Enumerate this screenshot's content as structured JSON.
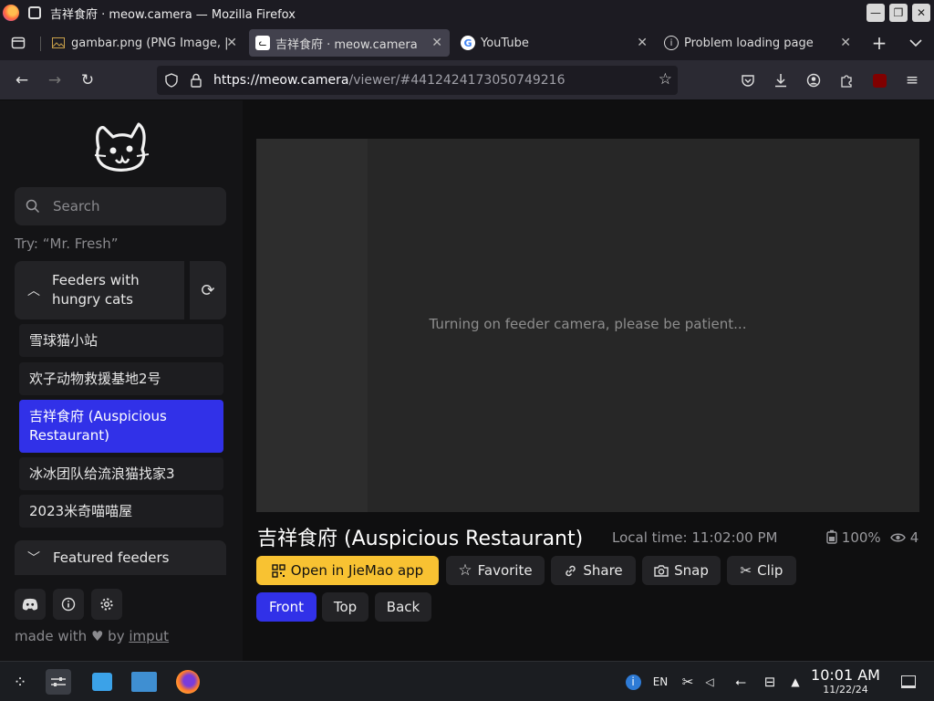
{
  "window": {
    "title": "吉祥食府 · meow.camera — Mozilla Firefox",
    "buttons": {
      "minimize": "—",
      "restore": "❐",
      "close": "✕"
    }
  },
  "tabs": [
    {
      "label": "gambar.png (PNG Image, |",
      "favicon": "image-file-icon"
    },
    {
      "label": "吉祥食府 · meow.camera",
      "favicon": "cat-icon",
      "active": true
    },
    {
      "label": "YouTube",
      "favicon": "google-icon"
    },
    {
      "label": "Problem loading page",
      "favicon": "info-icon"
    }
  ],
  "navbar": {
    "url_host": "https://meow.camera",
    "url_path": "/viewer/#4412424173050749216"
  },
  "sidebar": {
    "search_placeholder": "Search",
    "try_text": "Try: “Mr. Fresh”",
    "feeders_header": "Feeders with hungry cats",
    "feeders": [
      {
        "label": "雪球猫小站"
      },
      {
        "label": "欢子动物救援基地2号"
      },
      {
        "label": "吉祥食府 (Auspicious Restaurant)",
        "active": true
      },
      {
        "label": "冰冰团队给流浪猫找家3"
      },
      {
        "label": "2023米奇喵喵屋"
      }
    ],
    "featured_header": "Featured feeders",
    "made_with_prefix": "made with",
    "made_with_by": "by",
    "made_with_author": "imput"
  },
  "viewer": {
    "status_message": "Turning on feeder camera, please be patient...",
    "feeder_title": "吉祥食府 (Auspicious Restaurant)",
    "local_time": "Local time: 11:02:00 PM",
    "battery": "100%",
    "viewers": "4"
  },
  "actions": {
    "open_app": "Open in JieMao app",
    "favorite": "Favorite",
    "share": "Share",
    "snap": "Snap",
    "clip": "Clip"
  },
  "cameras": {
    "front": "Front",
    "top": "Top",
    "back": "Back"
  },
  "taskbar": {
    "language": "EN",
    "time": "10:01 AM",
    "date": "11/22/24"
  },
  "colors": {
    "accent_blue": "#3131e8",
    "open_app_yellow": "#f8c232"
  }
}
